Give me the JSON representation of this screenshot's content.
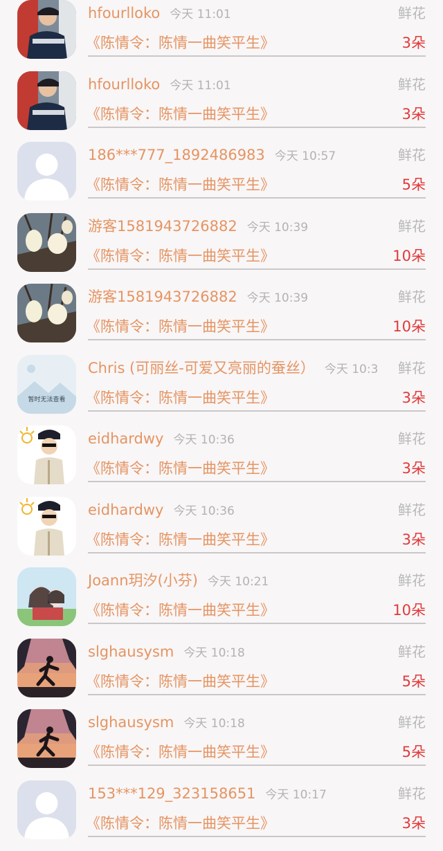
{
  "records": [
    {
      "avatar": "avatar-boy-cap-icon",
      "name": "hfourlloko",
      "time": "今天 11:01",
      "gift": "鲜花",
      "work": "《陈情令：陈情一曲笑平生》",
      "count": "3朵"
    },
    {
      "avatar": "avatar-boy-cap-icon",
      "name": "hfourlloko",
      "time": "今天 11:01",
      "gift": "鲜花",
      "work": "《陈情令：陈情一曲笑平生》",
      "count": "3朵"
    },
    {
      "avatar": "default-avatar-icon",
      "name": "186***777_1892486983",
      "time": "今天 10:57",
      "gift": "鲜花",
      "work": "《陈情令：陈情一曲笑平生》",
      "count": "5朵"
    },
    {
      "avatar": "magnolia-avatar-icon",
      "name": "游客1581943726882",
      "time": "今天 10:39",
      "gift": "鲜花",
      "work": "《陈情令：陈情一曲笑平生》",
      "count": "10朵"
    },
    {
      "avatar": "magnolia-avatar-icon",
      "name": "游客1581943726882",
      "time": "今天 10:39",
      "gift": "鲜花",
      "work": "《陈情令：陈情一曲笑平生》",
      "count": "10朵"
    },
    {
      "avatar": "image-unavailable-icon",
      "avatar_text": "暂时无法查看",
      "name": "Chris (可丽丝-可爱又亮丽的蚕丝）",
      "time": "今天 10:3",
      "gift": "鲜花",
      "work": "《陈情令：陈情一曲笑平生》",
      "count": "3朵"
    },
    {
      "avatar": "cartoon-officer-icon",
      "name": "eidhardwy",
      "time": "今天 10:36",
      "gift": "鲜花",
      "work": "《陈情令：陈情一曲笑平生》",
      "count": "3朵"
    },
    {
      "avatar": "cartoon-officer-icon",
      "name": "eidhardwy",
      "time": "今天 10:36",
      "gift": "鲜花",
      "work": "《陈情令：陈情一曲笑平生》",
      "count": "3朵"
    },
    {
      "avatar": "anime-couple-icon",
      "name": "Joann玥汐(小芬)",
      "time": "今天 10:21",
      "gift": "鲜花",
      "work": "《陈情令：陈情一曲笑平生》",
      "count": "10朵"
    },
    {
      "avatar": "runner-sunset-icon",
      "name": "slghausysm",
      "time": "今天 10:18",
      "gift": "鲜花",
      "work": "《陈情令：陈情一曲笑平生》",
      "count": "5朵"
    },
    {
      "avatar": "runner-sunset-icon",
      "name": "slghausysm",
      "time": "今天 10:18",
      "gift": "鲜花",
      "work": "《陈情令：陈情一曲笑平生》",
      "count": "5朵"
    },
    {
      "avatar": "default-avatar-icon",
      "name": "153***129_323158651",
      "time": "今天 10:17",
      "gift": "鲜花",
      "work": "《陈情令：陈情一曲笑平生》",
      "count": "3朵"
    }
  ]
}
